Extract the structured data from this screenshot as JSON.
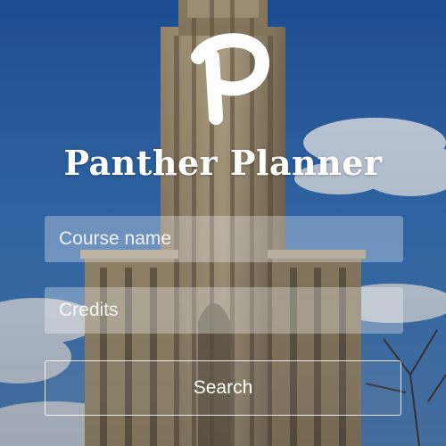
{
  "app": {
    "title": "Panther Planner",
    "logo_icon": "panther-p-logo-icon"
  },
  "form": {
    "course_placeholder": "Course name",
    "course_value": "",
    "credits_placeholder": "Credits",
    "credits_value": "",
    "search_label": "Search"
  },
  "colors": {
    "text": "#ffffff",
    "sky": "#2f6db5",
    "stone": "#8a7a60"
  }
}
